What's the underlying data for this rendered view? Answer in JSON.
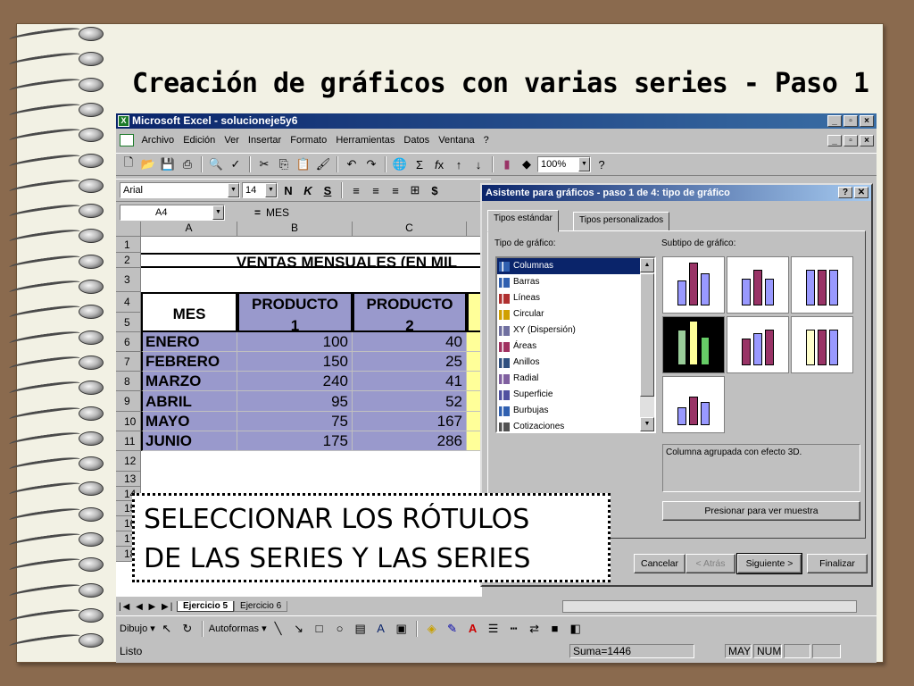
{
  "slide": {
    "title": "Creación de gráficos con varias series - Paso 1"
  },
  "excel": {
    "title": "Microsoft Excel - solucioneje5y6",
    "menu": [
      "Archivo",
      "Edición",
      "Ver",
      "Insertar",
      "Formato",
      "Herramientas",
      "Datos",
      "Ventana",
      "?"
    ],
    "zoom": "100%",
    "font": "Arial",
    "font_size": "14",
    "name_box": "A4",
    "formula_eq": "=",
    "formula_value": "MES",
    "columns": [
      "A",
      "B",
      "C"
    ],
    "rows": [
      "1",
      "2",
      "3",
      "4",
      "5",
      "6",
      "7",
      "8",
      "9",
      "10",
      "11",
      "12",
      "13",
      "14",
      "15",
      "16",
      "17",
      "18"
    ],
    "table_title": "VENTAS MENSUALES (EN MIL",
    "header_mes": "MES",
    "header_p1": "PRODUCTO 1",
    "header_p2": "PRODUCTO 2",
    "data": [
      {
        "mes": "ENERO",
        "p1": "100",
        "p2": "40"
      },
      {
        "mes": "FEBRERO",
        "p1": "150",
        "p2": "25"
      },
      {
        "mes": "MARZO",
        "p1": "240",
        "p2": "41"
      },
      {
        "mes": "ABRIL",
        "p1": "95",
        "p2": "52"
      },
      {
        "mes": "MAYO",
        "p1": "75",
        "p2": "167"
      },
      {
        "mes": "JUNIO",
        "p1": "175",
        "p2": "286"
      }
    ],
    "sheet_tabs": [
      "Ejercicio 5",
      "Ejercicio 6"
    ],
    "draw_label": "Dibujo ▾",
    "autoshapes_label": "Autoformas ▾",
    "status": "Listo",
    "sum": "Suma=1446",
    "may": "MAY",
    "num": "NUM"
  },
  "dialog": {
    "title": "Asistente para gráficos - paso 1 de 4: tipo de gráfico",
    "help": "?",
    "close": "✕",
    "tab_standard": "Tipos estándar",
    "tab_custom": "Tipos personalizados",
    "type_label": "Tipo de gráfico:",
    "subtype_label": "Subtipo de gráfico:",
    "types": [
      "Columnas",
      "Barras",
      "Líneas",
      "Circular",
      "XY (Dispersión)",
      "Áreas",
      "Anillos",
      "Radial",
      "Superficie",
      "Burbujas",
      "Cotizaciones"
    ],
    "description": "Columna agrupada con efecto 3D.",
    "preview_button": "Presionar para ver muestra",
    "cancel": "Cancelar",
    "back": "< Atrás",
    "next": "Siguiente >",
    "finish": "Finalizar"
  },
  "note": {
    "line1": "SELECCIONAR LOS RÓTULOS",
    "line2": "DE LAS SERIES Y LAS SERIES"
  },
  "colors": {
    "accent": "#0a246a",
    "cell_blue": "#9999cc",
    "cell_yellow": "#ffff99",
    "bar_purple": "#993366",
    "bar_blue": "#9999ff"
  }
}
